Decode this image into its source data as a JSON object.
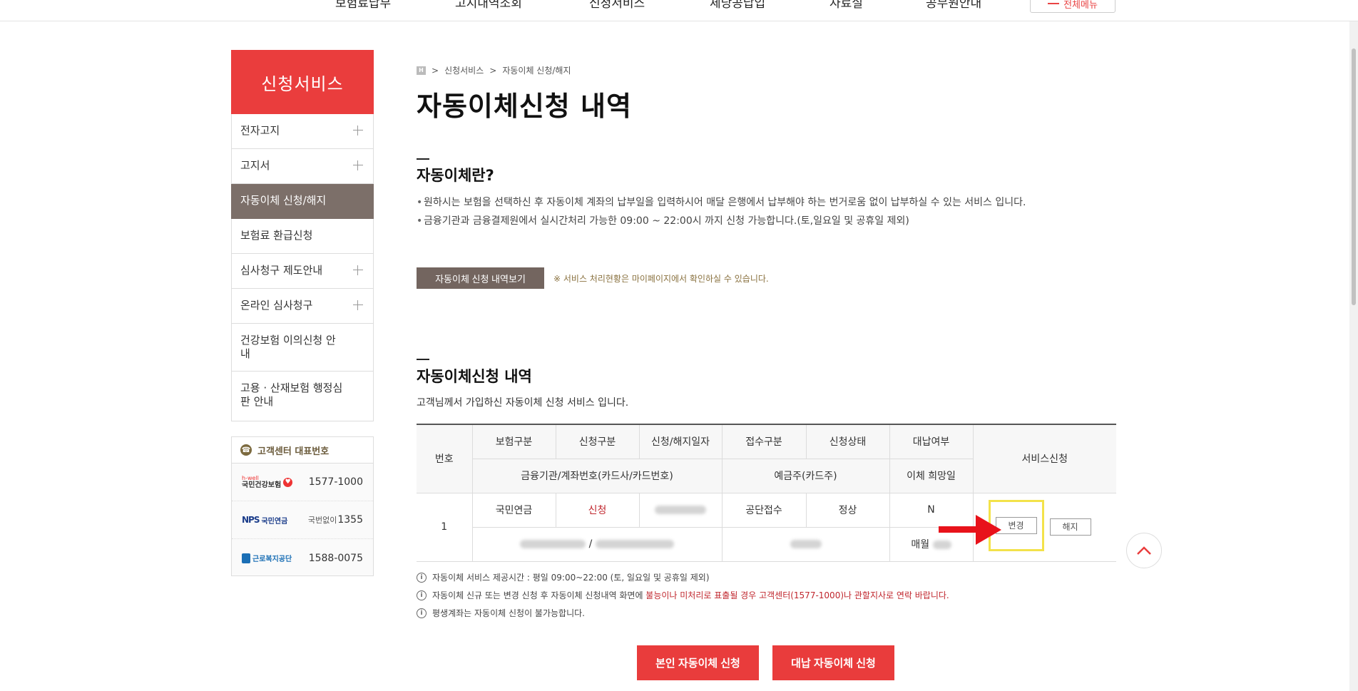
{
  "topnav": {
    "items": [
      "보험료납부",
      "고지내역조회",
      "신청서비스",
      "체당공납입",
      "자료실",
      "공무원안내"
    ],
    "all_menu": "전체메뉴"
  },
  "sidebar": {
    "title": "신청서비스",
    "items": [
      {
        "label": "전자고지",
        "expandable": true
      },
      {
        "label": "고지서",
        "expandable": true
      },
      {
        "label": "자동이체 신청/해지",
        "active": true
      },
      {
        "label": "보험료 환급신청"
      },
      {
        "label": "심사청구 제도안내",
        "expandable": true
      },
      {
        "label": "온라인 심사청구",
        "expandable": true
      },
      {
        "label": "건강보험 이의신청 안내"
      },
      {
        "label": "고용 · 산재보험 행정심판 안내"
      }
    ]
  },
  "callcenter": {
    "title": "고객센터 대표번호",
    "rows": [
      {
        "logo": "국민건강보험",
        "logo_sub": "h-well",
        "number": "1577-1000"
      },
      {
        "logo": "국민연금",
        "logo_mark": "NPS",
        "prefix": "국번없이",
        "number": "1355"
      },
      {
        "logo": "근로복지공단",
        "number": "1588-0075"
      }
    ]
  },
  "breadcrumb": [
    "신청서비스",
    "자동이체 신청/해지"
  ],
  "breadcrumb_home": "H",
  "page_title": "자동이체신청 내역",
  "section1": {
    "title": "자동이체란?",
    "bullets": [
      "원하시는 보험을 선택하신 후 자동이체 계좌의 납부일을 입력하시어 매달 은행에서 납부해야 하는 번거로움 없이 납부하실 수 있는 서비스 입니다.",
      "금융기관과 금융결제원에서 실시간처리 가능한 09:00 ~ 22:00시 까지 신청 가능합니다.(토,일요일 및 공휴일 제외)"
    ],
    "history_button": "자동이체 신청 내역보기",
    "history_note": "※ 서비스 처리현황은 마이페이지에서 확인하실 수 있습니다."
  },
  "section2": {
    "title": "자동이체신청 내역",
    "desc": "고객님께서 가입하신 자동이체 신청 서비스 입니다.",
    "headers": {
      "no": "번호",
      "insurance": "보험구분",
      "apply_type": "신청구분",
      "date": "신청/해지일자",
      "receipt": "접수구분",
      "status": "신청상태",
      "proxy": "대납여부",
      "service": "서비스신청",
      "bank": "금융기관/계좌번호(카드사/카드번호)",
      "holder": "예금주(카드주)",
      "wish_day": "이체 희망일"
    },
    "row": {
      "no": "1",
      "insurance": "국민연금",
      "apply_type": "신청",
      "receipt": "공단접수",
      "status": "정상",
      "proxy": "N",
      "bank_sep": "/",
      "wish_prefix": "매월",
      "change_button": "변경",
      "cancel_button": "해지"
    }
  },
  "notes": {
    "n1": "자동이체 서비스 제공시간 : 평일 09:00~22:00 (토, 일요일 및 공휴일 제외)",
    "n2_pre": "자동이체 신규 또는 변경 신청 후 자동이체 신청내역 화면에 ",
    "n2_hl": "불능이나 미처리로 표출될 경우 고객센터(1577-1000)나 관할지사로 연락 바랍니다.",
    "n3": "평생계좌는 자동이체 신청이 불가능합니다."
  },
  "buttons": {
    "self_apply": "본인 자동이체 신청",
    "proxy_apply": "대납 자동이체 신청"
  },
  "colors": {
    "brand_red": "#ea3d3d",
    "active_brown": "#7c6f69",
    "highlight": "#f3e24a",
    "arrow_red": "#e8121a"
  }
}
